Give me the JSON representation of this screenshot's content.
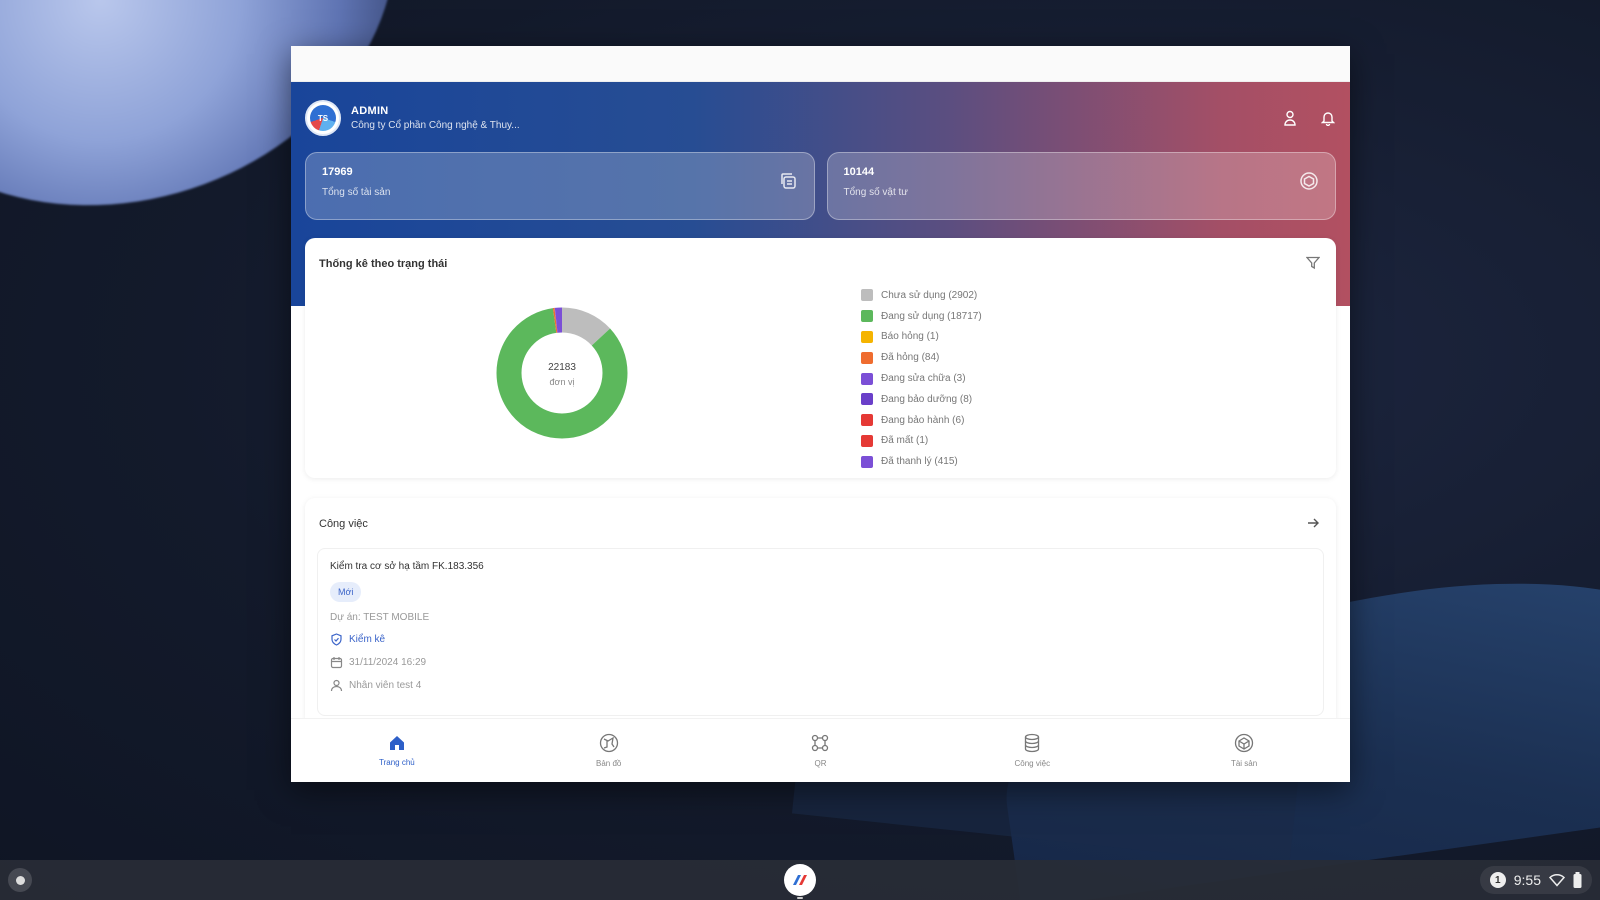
{
  "header": {
    "user_name": "ADMIN",
    "company": "Công ty Cổ phần Công nghệ & Thuy..."
  },
  "stats": [
    {
      "value": "17969",
      "label": "Tổng số tài sản",
      "icon": "copy-icon"
    },
    {
      "value": "10144",
      "label": "Tổng số vật tư",
      "icon": "box-icon"
    }
  ],
  "status_card": {
    "title": "Thống kê theo trạng thái",
    "center_value": "22183",
    "center_unit": "đơn vị",
    "legend": [
      {
        "label": "Chưa sử dụng (2902)",
        "color": "#bdbdbd",
        "value": 2902
      },
      {
        "label": "Đang sử dụng (18717)",
        "color": "#5cb85c",
        "value": 18717
      },
      {
        "label": "Báo hỏng (1)",
        "color": "#f5b400",
        "value": 1
      },
      {
        "label": "Đã hỏng (84)",
        "color": "#ef6c2f",
        "value": 84
      },
      {
        "label": "Đang sửa chữa (3)",
        "color": "#7b4fd6",
        "value": 3
      },
      {
        "label": "Đang bảo dưỡng (8)",
        "color": "#6a3fc9",
        "value": 8
      },
      {
        "label": "Đang bảo hành (6)",
        "color": "#e53935",
        "value": 6
      },
      {
        "label": "Đã mất (1)",
        "color": "#e53935",
        "value": 1
      },
      {
        "label": "Đã thanh lý (415)",
        "color": "#7b4fd6",
        "value": 415
      }
    ]
  },
  "tasks": {
    "title": "Công việc",
    "item": {
      "title": "Kiểm tra cơ sở hạ tầm FK.183.356",
      "tag": "Mới",
      "project": "Dự án: TEST MOBILE",
      "type": "Kiểm kê",
      "datetime": "31/11/2024 16:29",
      "assignee": "Nhân viên test 4"
    }
  },
  "nav": [
    {
      "label": "Trang chủ",
      "icon": "home-icon",
      "active": true
    },
    {
      "label": "Bản đồ",
      "icon": "map-icon",
      "active": false
    },
    {
      "label": "QR",
      "icon": "qr-icon",
      "active": false
    },
    {
      "label": "Công việc",
      "icon": "tasks-icon",
      "active": false
    },
    {
      "label": "Tài sản",
      "icon": "assets-icon",
      "active": false
    }
  ],
  "shelf": {
    "notification_count": "1",
    "time": "9:55"
  }
}
